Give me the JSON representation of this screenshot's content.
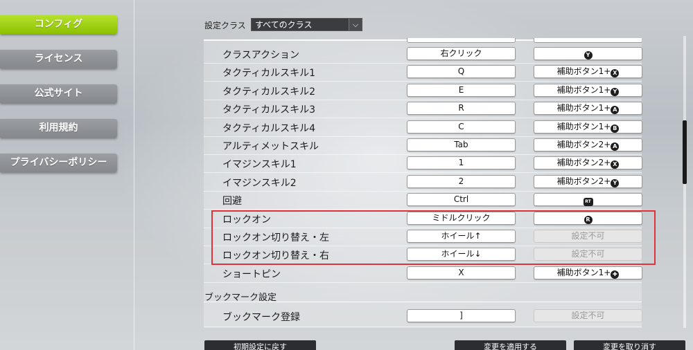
{
  "sidebar": {
    "items": [
      {
        "label": "コンフィグ",
        "active": true
      },
      {
        "label": "ライセンス",
        "active": false
      },
      {
        "label": "公式サイト",
        "active": false
      },
      {
        "label": "利用規約",
        "active": false
      },
      {
        "label": "プライバシーポリシー",
        "active": false
      }
    ]
  },
  "class_filter": {
    "label": "設定クラス",
    "selected": "すべてのクラス"
  },
  "rows": [
    {
      "label": "クラスアクション",
      "key": "右クリック",
      "pad_text": "",
      "pad_icon": "Y",
      "pad_disabled": false
    },
    {
      "label": "タクティカルスキル1",
      "key": "Q",
      "pad_text": "補助ボタン1+",
      "pad_icon": "X",
      "pad_disabled": false
    },
    {
      "label": "タクティカルスキル2",
      "key": "E",
      "pad_text": "補助ボタン1+",
      "pad_icon": "Y",
      "pad_disabled": false
    },
    {
      "label": "タクティカルスキル3",
      "key": "R",
      "pad_text": "補助ボタン1+",
      "pad_icon": "A",
      "pad_disabled": false
    },
    {
      "label": "タクティカルスキル4",
      "key": "C",
      "pad_text": "補助ボタン1+",
      "pad_icon": "B",
      "pad_disabled": false
    },
    {
      "label": "アルティメットスキル",
      "key": "Tab",
      "pad_text": "補助ボタン2+",
      "pad_icon": "A",
      "pad_disabled": false
    },
    {
      "label": "イマジンスキル1",
      "key": "1",
      "pad_text": "補助ボタン2+",
      "pad_icon": "X",
      "pad_disabled": false
    },
    {
      "label": "イマジンスキル2",
      "key": "2",
      "pad_text": "補助ボタン2+",
      "pad_icon": "Y",
      "pad_disabled": false
    },
    {
      "label": "回避",
      "key": "Ctrl",
      "pad_text": "",
      "pad_icon": "RT",
      "pad_disabled": false
    },
    {
      "label": "ロックオン",
      "key": "ミドルクリック",
      "pad_text": "",
      "pad_icon": "R",
      "pad_disabled": false
    },
    {
      "label": "ロックオン切り替え・左",
      "key": "ホイール↑",
      "pad_text": "設定不可",
      "pad_icon": "",
      "pad_disabled": true
    },
    {
      "label": "ロックオン切り替え・右",
      "key": "ホイール↓",
      "pad_text": "設定不可",
      "pad_icon": "",
      "pad_disabled": true
    },
    {
      "label": "ショートピン",
      "key": "X",
      "pad_text": "補助ボタン1+",
      "pad_icon": "✚",
      "pad_disabled": false
    }
  ],
  "bookmark_section": {
    "title": "ブックマーク設定",
    "row": {
      "label": "ブックマーク登録",
      "key": "]",
      "pad_text": "設定不可",
      "pad_disabled": true
    }
  },
  "footer": {
    "reset_label": "初期設定に戻す",
    "apply_label": "変更を適用する",
    "cancel_label": "変更を取り消す"
  },
  "colors": {
    "active_nav": "#8dc100",
    "highlight": "#e0323a"
  }
}
